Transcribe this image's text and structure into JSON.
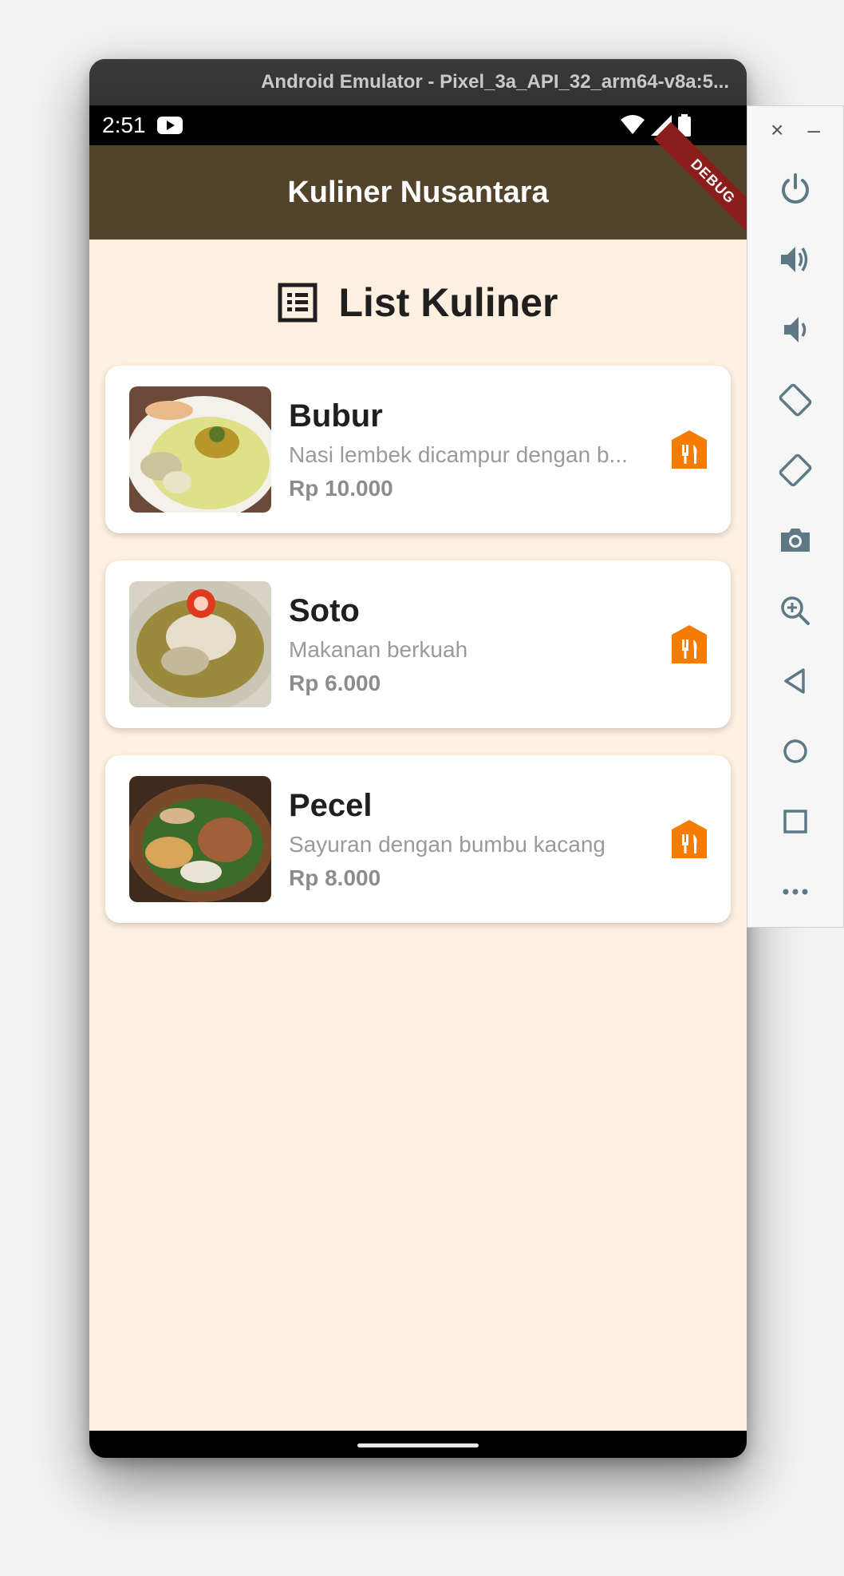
{
  "window": {
    "title": "Android Emulator - Pixel_3a_API_32_arm64-v8a:5..."
  },
  "status_bar": {
    "time": "2:51"
  },
  "app_bar": {
    "title": "Kuliner Nusantara",
    "debug_label": "DEBUG"
  },
  "section": {
    "title": "List Kuliner",
    "icon": "list-alt-icon"
  },
  "items": [
    {
      "name": "Bubur",
      "description": "Nasi lembek dicampur dengan b...",
      "price": "Rp 10.000",
      "image": "bubur-photo",
      "action_icon": "store-fork-icon"
    },
    {
      "name": "Soto",
      "description": "Makanan berkuah",
      "price": "Rp 6.000",
      "image": "soto-photo",
      "action_icon": "store-fork-icon"
    },
    {
      "name": "Pecel",
      "description": "Sayuran dengan bumbu kacang",
      "price": "Rp 8.000",
      "image": "pecel-photo",
      "action_icon": "store-fork-icon"
    }
  ],
  "side_toolbar": {
    "close_glyph": "×",
    "minimize_glyph": "–",
    "tools": [
      "power-icon",
      "volume-up-icon",
      "volume-down-icon",
      "rotate-left-icon",
      "rotate-right-icon",
      "camera-icon",
      "zoom-icon",
      "back-icon",
      "home-icon",
      "overview-icon",
      "more-icon"
    ]
  },
  "colors": {
    "app_bar": "#52432a",
    "background": "#fdf0e0",
    "accent": "#f57c00",
    "debug_banner": "#8b1d1d",
    "toolbar_icon": "#5f7886"
  }
}
